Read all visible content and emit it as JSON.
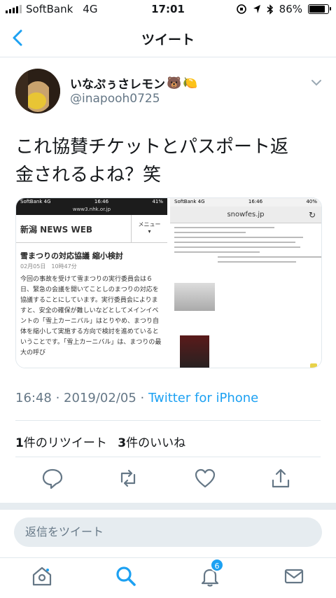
{
  "status_bar": {
    "carrier": "SoftBank",
    "network": "4G",
    "time": "17:01",
    "battery": "86%",
    "battery_level": 0.86
  },
  "nav": {
    "title": "ツイート"
  },
  "tweet": {
    "display_name": "いなぷぅさレモン",
    "name_emojis": [
      "🐻",
      "🍋"
    ],
    "handle": "@inapooh0725",
    "text_line1": "これ協賛チケットとパスポート返",
    "text_line2": "金されるよね？笑",
    "timestamp": "16:48 · 2019/02/05 · ",
    "source": "Twitter for iPhone",
    "retweet_count": "1",
    "retweet_label": "件のリツイート",
    "like_count": "3",
    "like_label": "件のいいね"
  },
  "media": {
    "image1": {
      "status_carrier": "SoftBank 4G",
      "status_time": "16:46",
      "status_battery": "41%",
      "url": "www3.nhk.or.jp",
      "brand": "新潟 NEWS WEB",
      "menu": "メニュー",
      "headline": "雪まつりの対応協議 縮小検討",
      "date": "02月05日　10時47分",
      "body": "今回の事故を受けて雪まつりの実行委員会は６日、緊急の会議を開いてことしのまつりの対応を協議することにしています。実行委員会によりますと、安全の確保が難しいなどとしてメインイベントの「雪上カーニバル」はとりやめ、まつり自体を縮小して実施する方向で検討を進めているということです。「雪上カーニバル」は、まつりの最大の呼び"
    },
    "image2": {
      "status_carrier": "SoftBank 4G",
      "status_time": "16:46",
      "status_battery": "40%",
      "url": "snowfes.jp"
    }
  },
  "reply": {
    "placeholder": "返信をツイート"
  },
  "tabs": {
    "notifications_badge": "6"
  },
  "colors": {
    "accent": "#1da1f2",
    "secondary_text": "#657786",
    "divider": "#e1e8ed"
  }
}
